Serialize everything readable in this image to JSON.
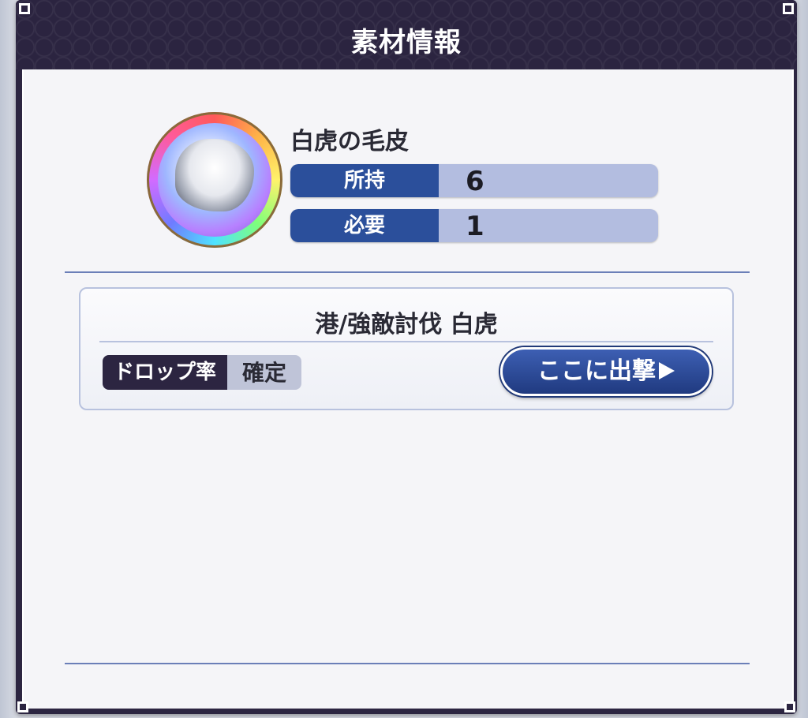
{
  "dialog": {
    "title": "素材情報"
  },
  "item": {
    "name": "白虎の毛皮",
    "icon": "white-fur-icon",
    "owned_label": "所持",
    "owned_value": "6",
    "required_label": "必要",
    "required_value": "1"
  },
  "stage": {
    "title": "港/強敵討伐 白虎",
    "drop_label": "ドロップ率",
    "drop_value": "確定",
    "sortie_label": "ここに出撃"
  },
  "colors": {
    "header_bg": "#2b2440",
    "label_bg": "#2b4f9b",
    "value_bg": "#b3bde0",
    "button_bg": "#203a80",
    "body_bg": "#f5f5f8"
  }
}
